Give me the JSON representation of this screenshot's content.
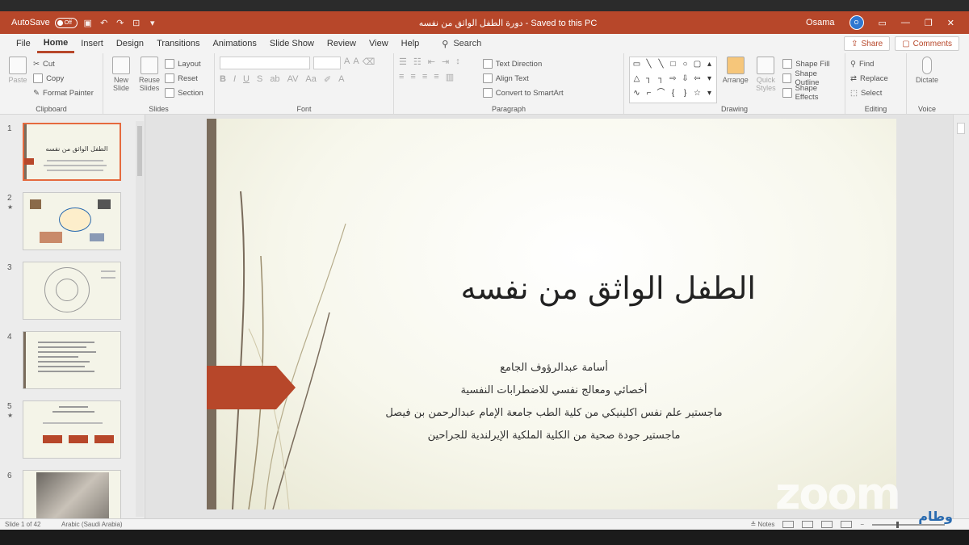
{
  "titlebar": {
    "autosave_label": "AutoSave",
    "autosave_state": "Off",
    "doc_title": "دورة الطفل الواثق من نفسه  -  Saved to this PC",
    "user_name": "Osama",
    "user_initial": "O"
  },
  "menu": {
    "tabs": [
      "File",
      "Home",
      "Insert",
      "Design",
      "Transitions",
      "Animations",
      "Slide Show",
      "Review",
      "View",
      "Help"
    ],
    "search_label": "Search",
    "share_label": "Share",
    "comments_label": "Comments"
  },
  "ribbon": {
    "clipboard": {
      "paste": "Paste",
      "cut": "Cut",
      "copy": "Copy",
      "format_painter": "Format Painter",
      "label": "Clipboard"
    },
    "slides": {
      "new_slide": "New Slide",
      "reuse_slides": "Reuse Slides",
      "layout": "Layout",
      "reset": "Reset",
      "section": "Section",
      "label": "Slides"
    },
    "font": {
      "label": "Font"
    },
    "paragraph": {
      "text_direction": "Text Direction",
      "align_text": "Align Text",
      "convert_smartart": "Convert to SmartArt",
      "label": "Paragraph"
    },
    "drawing": {
      "arrange": "Arrange",
      "quick_styles": "Quick Styles",
      "shape_fill": "Shape Fill",
      "shape_outline": "Shape Outline",
      "shape_effects": "Shape Effects",
      "label": "Drawing"
    },
    "editing": {
      "find": "Find",
      "replace": "Replace",
      "select": "Select",
      "label": "Editing"
    },
    "voice": {
      "dictate": "Dictate",
      "label": "Voice"
    }
  },
  "thumbnails": [
    {
      "num": "1",
      "star": "",
      "caption": "الطفل الواثق من نفسه"
    },
    {
      "num": "2",
      "star": "★",
      "caption": ""
    },
    {
      "num": "3",
      "star": "",
      "caption": ""
    },
    {
      "num": "4",
      "star": "",
      "caption": ""
    },
    {
      "num": "5",
      "star": "★",
      "caption": ""
    },
    {
      "num": "6",
      "star": "",
      "caption": ""
    }
  ],
  "slide": {
    "title": "الطفل الواثق من نفسه",
    "lines": [
      "أسامة عبدالرؤوف الجامع",
      "أخصائي ومعالج نفسي للاضطرابات النفسية",
      "ماجستير علم نفس اكلينيكي من كلية الطب جامعة الإمام عبدالرحمن بن فيصل",
      "ماجستير جودة صحية من الكلية الملكية الإيرلندية للجراحين"
    ]
  },
  "status": {
    "slide_info": "Slide 1 of 42",
    "language": "Arabic (Saudi Arabia)",
    "notes": "Notes"
  },
  "watermarks": {
    "zoom": "zoom",
    "logo": "وطام"
  },
  "colors": {
    "accent": "#b7472a",
    "slide_arrow": "#b7472a"
  }
}
